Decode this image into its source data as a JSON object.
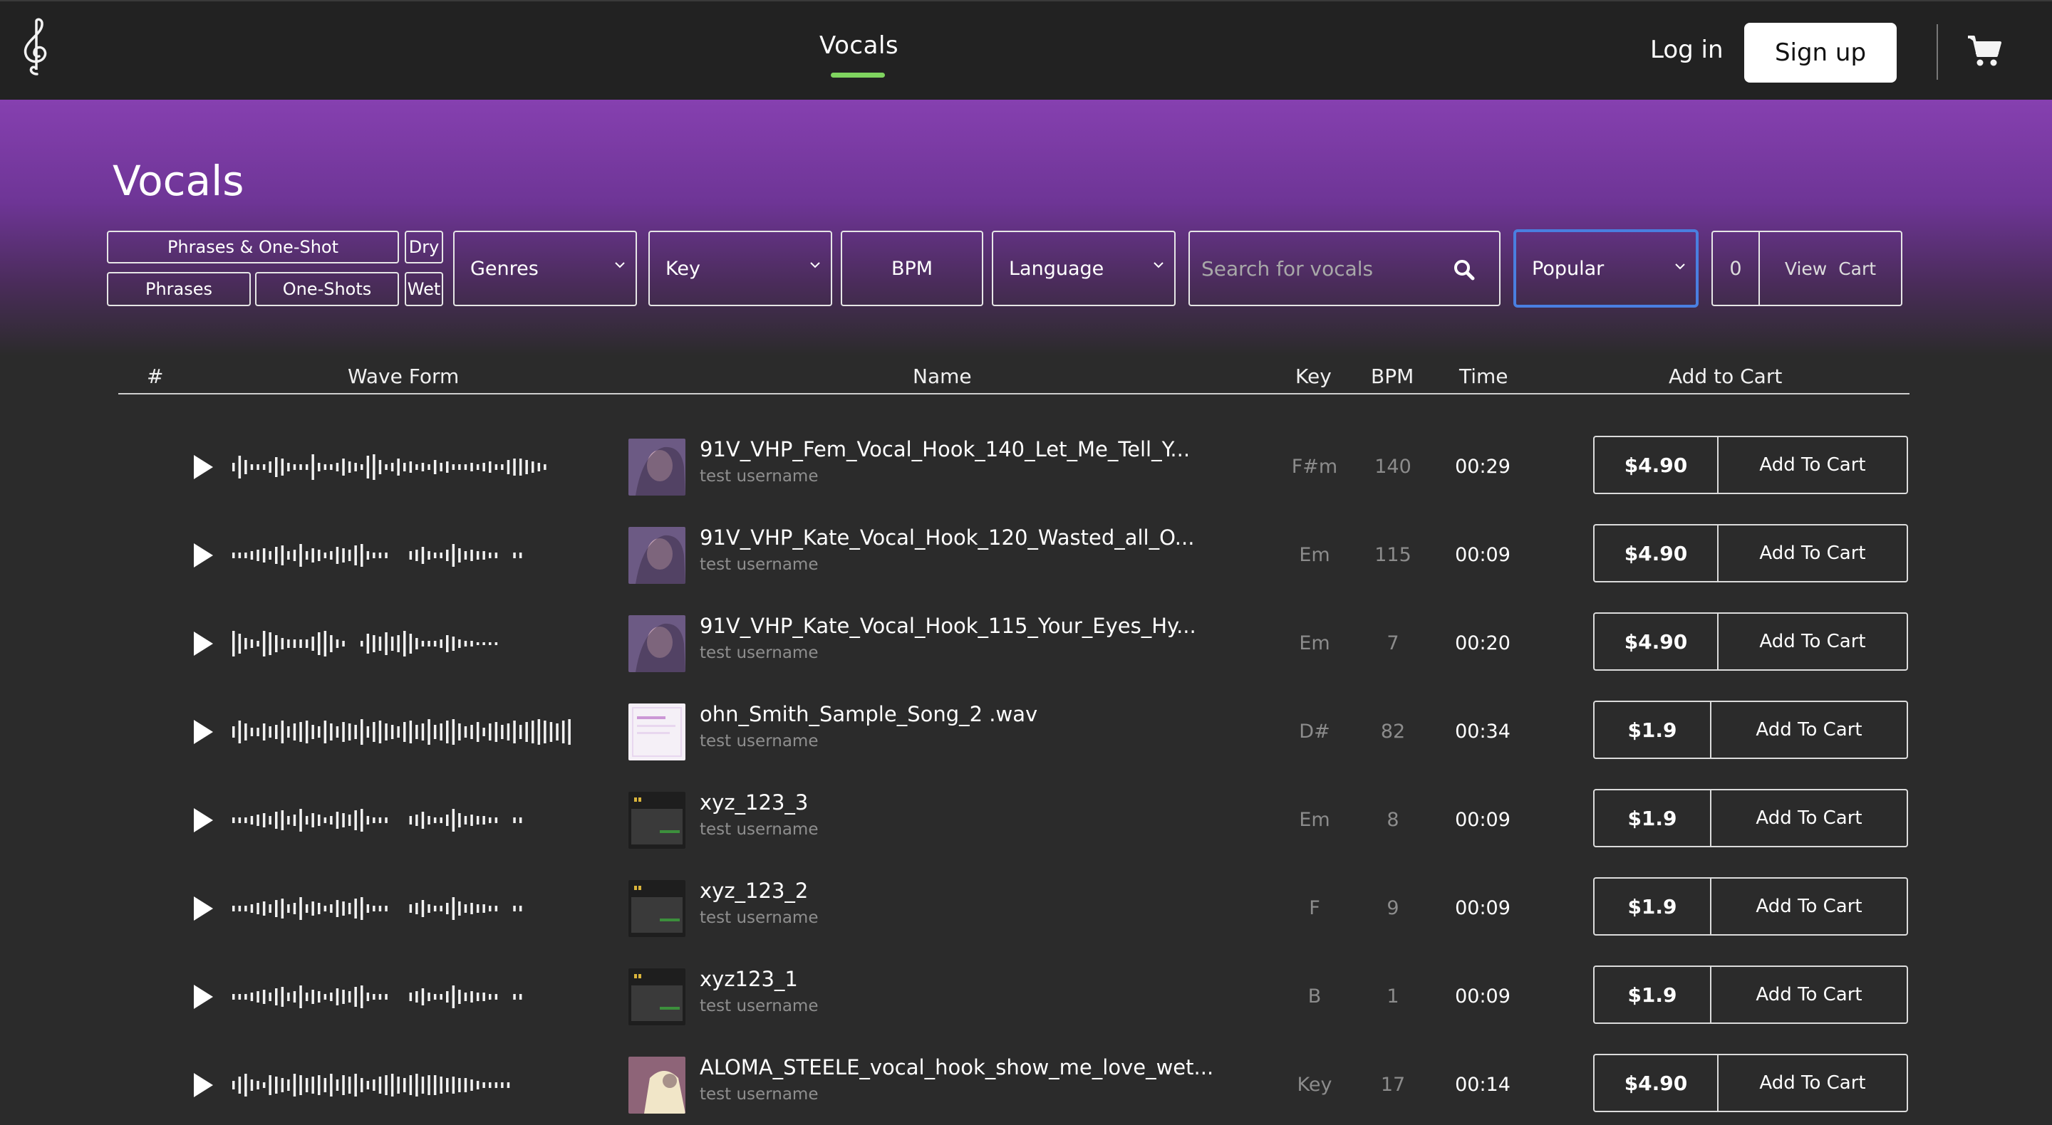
{
  "nav": {
    "center_tab": "Vocals",
    "login": "Log in",
    "signup": "Sign up",
    "accent_color": "#7fd45f"
  },
  "page": {
    "title": "Vocals"
  },
  "filters": {
    "phrases_oneshot": "Phrases  &  One-Shot",
    "phrases": "Phrases",
    "oneshots": "One-Shots",
    "dry": "Dry",
    "wet": "Wet",
    "genres": "Genres",
    "key": "Key",
    "bpm": "BPM",
    "language": "Language",
    "search_placeholder": "Search for vocals",
    "sort": "Popular",
    "cart_count": "0",
    "view_cart": "View Cart"
  },
  "table": {
    "headers": {
      "num": "#",
      "waveform": "Wave Form",
      "name": "Name",
      "key": "Key",
      "bpm": "BPM",
      "time": "Time",
      "add_to_cart": "Add to Cart"
    },
    "rows": [
      {
        "title": "91V_VHP_Fem_Vocal_Hook_140_Let_Me_Tell_Y...",
        "user": "test username",
        "key": "F#m",
        "bpm": "140",
        "time": "00:29",
        "price": "$4.90",
        "add": "Add To Cart",
        "thumb": "portrait",
        "wave": "a"
      },
      {
        "title": "91V_VHP_Kate_Vocal_Hook_120_Wasted_all_O...",
        "user": "test username",
        "key": "Em",
        "bpm": "115",
        "time": "00:09",
        "price": "$4.90",
        "add": "Add To Cart",
        "thumb": "portrait",
        "wave": "b"
      },
      {
        "title": "91V_VHP_Kate_Vocal_Hook_115_Your_Eyes_Hy...",
        "user": "test username",
        "key": "Em",
        "bpm": "7",
        "time": "00:20",
        "price": "$4.90",
        "add": "Add To Cart",
        "thumb": "portrait",
        "wave": "c"
      },
      {
        "title": "ohn_Smith_Sample_Song_2 .wav",
        "user": "test username",
        "key": "D#",
        "bpm": "82",
        "time": "00:34",
        "price": "$1.9",
        "add": "Add To Cart",
        "thumb": "doc",
        "wave": "d"
      },
      {
        "title": "xyz_123_3",
        "user": "test username",
        "key": "Em",
        "bpm": "8",
        "time": "00:09",
        "price": "$1.9",
        "add": "Add To Cart",
        "thumb": "screen",
        "wave": "b"
      },
      {
        "title": "xyz_123_2",
        "user": "test username",
        "key": "F",
        "bpm": "9",
        "time": "00:09",
        "price": "$1.9",
        "add": "Add To Cart",
        "thumb": "screen",
        "wave": "b"
      },
      {
        "title": "xyz123_1",
        "user": "test username",
        "key": "B",
        "bpm": "1",
        "time": "00:09",
        "price": "$1.9",
        "add": "Add To Cart",
        "thumb": "screen",
        "wave": "b"
      },
      {
        "title": "ALOMA_STEELE_vocal_hook_show_me_love_wet...",
        "user": "test username",
        "key": "Key",
        "bpm": "17",
        "time": "00:14",
        "price": "$4.90",
        "add": "Add To Cart",
        "thumb": "pink",
        "wave": "e"
      }
    ]
  }
}
